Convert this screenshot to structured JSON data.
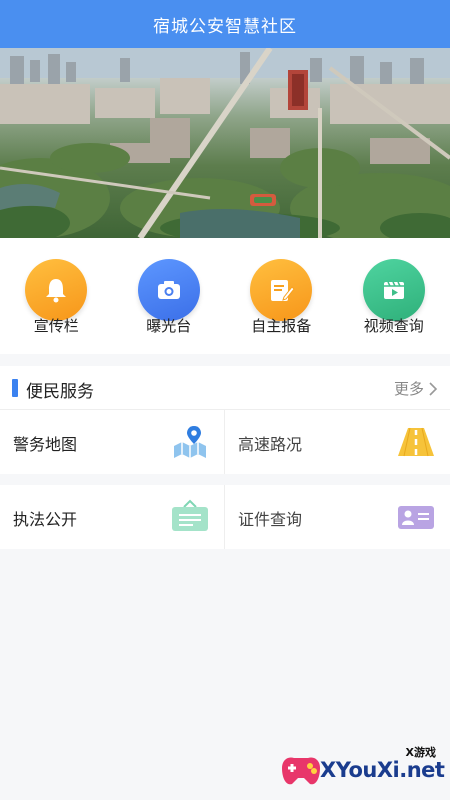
{
  "header": {
    "title": "宿城公安智慧社区"
  },
  "quick": [
    {
      "label": "宣传栏",
      "icon": "bell-icon",
      "color": "#f7a11f"
    },
    {
      "label": "曝光台",
      "icon": "camera-icon",
      "color": "#4a7ff0"
    },
    {
      "label": "自主报备",
      "icon": "report-edit-icon",
      "color": "#f7a11f"
    },
    {
      "label": "视频查询",
      "icon": "video-icon",
      "color": "#3fbf8a"
    }
  ],
  "services": {
    "title": "便民服务",
    "more": "更多",
    "items": [
      {
        "label": "警务地图",
        "icon": "map-pin-icon"
      },
      {
        "label": "高速路况",
        "icon": "road-icon"
      },
      {
        "label": "执法公开",
        "icon": "notice-board-icon"
      },
      {
        "label": "证件查询",
        "icon": "id-card-icon"
      }
    ]
  },
  "watermark": {
    "domain": "XYouXi.net",
    "cn": "X游戏"
  }
}
